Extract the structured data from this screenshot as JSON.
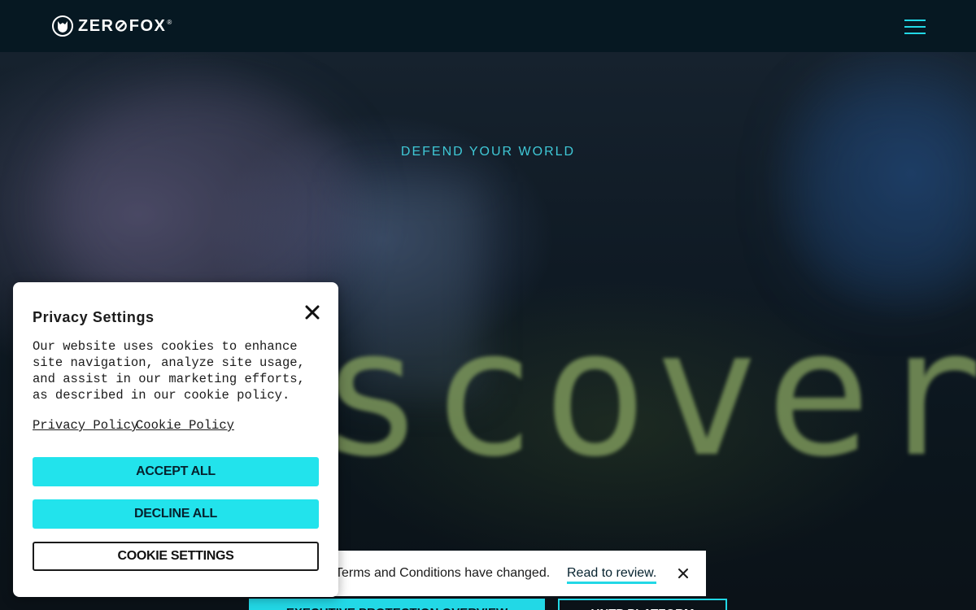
{
  "header": {
    "brand_name": "ZER⊘FOX",
    "brand_tm": "®",
    "menu_icon": "hamburger-menu-icon",
    "accent_color": "#22d8e6"
  },
  "hero": {
    "kicker": "DEFEND YOUR WORLD",
    "headline_word": "scover",
    "primary_cta": "EXECUTIVE PROTECTION OVERVIEW",
    "secondary_cta": "UNTP PLATFORM"
  },
  "terms_notice": {
    "text": "Terms and Conditions have changed.",
    "link": "Read to review.",
    "close_icon": "close-icon"
  },
  "privacy_dialog": {
    "title": "Privacy Settings",
    "body": "Our website uses cookies to enhance site navigation, analyze site usage, and assist in our marketing efforts, as described in our cookie policy.",
    "privacy_policy_link": "Privacy Policy",
    "cookie_policy_link": "Cookie Policy",
    "accept_all_label": "ACCEPT ALL",
    "decline_all_label": "DECLINE ALL",
    "cookie_settings_label": "COOKIE SETTINGS",
    "close_icon": "close-icon",
    "button_color": "#22e3ec"
  }
}
